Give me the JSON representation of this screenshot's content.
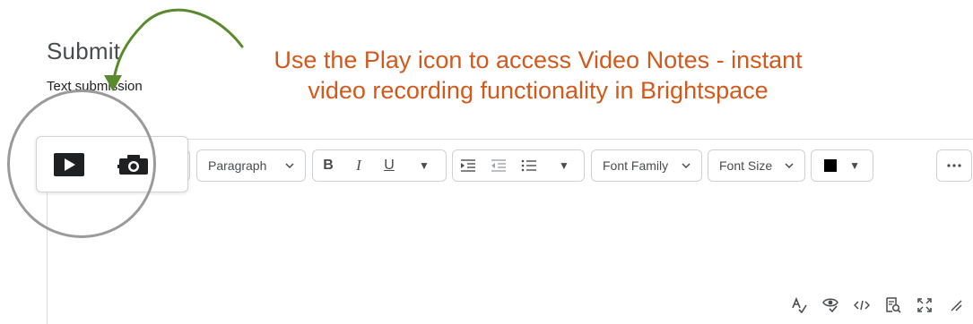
{
  "page": {
    "title": "Submit",
    "field_label": "Text submission"
  },
  "callout": {
    "line1": "Use the Play icon to access Video Notes - instant",
    "line2": "video recording functionality in Brightspace"
  },
  "toolbar": {
    "media": {
      "play_icon": "play-icon",
      "camera_icon": "camera-icon"
    },
    "paragraph_label": "Paragraph",
    "format": {
      "bold": "B",
      "italic": "I",
      "underline": "U"
    },
    "font_family_label": "Font Family",
    "font_size_label": "Font Size",
    "color_swatch": "#000000"
  },
  "colors": {
    "callout": "#d2591c",
    "arrow": "#5a8a2e",
    "magnifier": "#9a9a9a",
    "icon": "#494c4e"
  }
}
